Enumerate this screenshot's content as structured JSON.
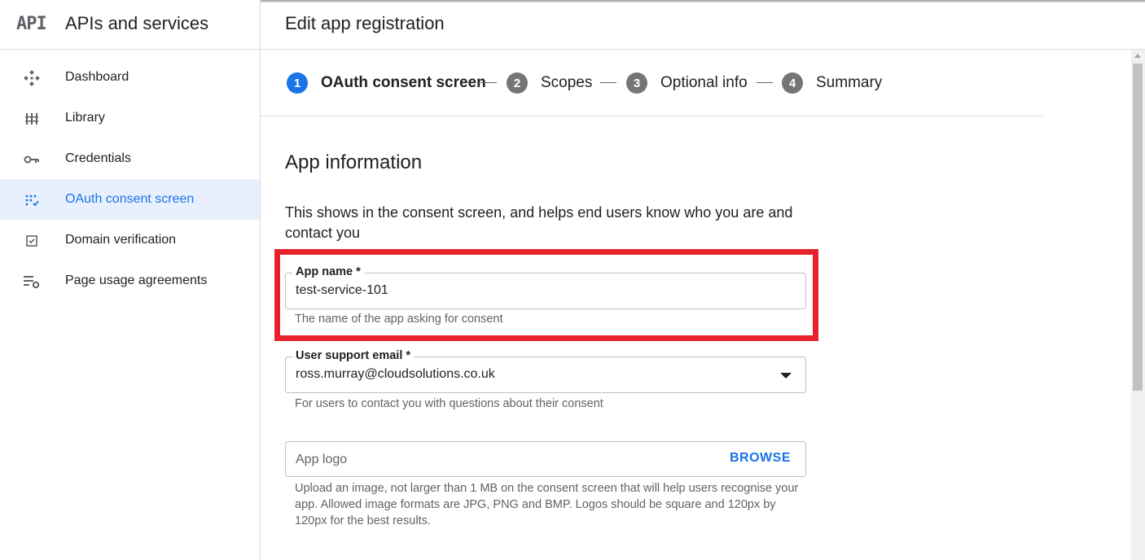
{
  "sidebar": {
    "logo_text": "API",
    "title": "APIs and services",
    "items": [
      {
        "label": "Dashboard",
        "icon": "dashboard-icon"
      },
      {
        "label": "Library",
        "icon": "library-icon"
      },
      {
        "label": "Credentials",
        "icon": "key-icon"
      },
      {
        "label": "OAuth consent screen",
        "icon": "consent-icon",
        "active": true
      },
      {
        "label": "Domain verification",
        "icon": "checkbox-icon"
      },
      {
        "label": "Page usage agreements",
        "icon": "settings-list-icon"
      }
    ]
  },
  "header": {
    "title": "Edit app registration"
  },
  "stepper": {
    "steps": [
      {
        "number": "1",
        "label": "OAuth consent screen",
        "active": true
      },
      {
        "number": "2",
        "label": "Scopes"
      },
      {
        "number": "3",
        "label": "Optional info"
      },
      {
        "number": "4",
        "label": "Summary"
      }
    ]
  },
  "form": {
    "section_title": "App information",
    "section_desc": "This shows in the consent screen, and helps end users know who you are and contact you",
    "app_name": {
      "label": "App name *",
      "value": "test-service-101",
      "hint": "The name of the app asking for consent"
    },
    "support_email": {
      "label": "User support email *",
      "value": "ross.murray@cloudsolutions.co.uk",
      "hint": "For users to contact you with questions about their consent"
    },
    "app_logo": {
      "placeholder": "App logo",
      "browse_label": "BROWSE",
      "hint": "Upload an image, not larger than 1 MB on the consent screen that will help users recognise your app. Allowed image formats are JPG, PNG and BMP. Logos should be square and 120px by 120px for the best results."
    }
  },
  "colors": {
    "accent": "#1a73e8",
    "active_bg": "#e8f0fe",
    "highlight": "#e8222c",
    "step_inactive": "#757575"
  }
}
